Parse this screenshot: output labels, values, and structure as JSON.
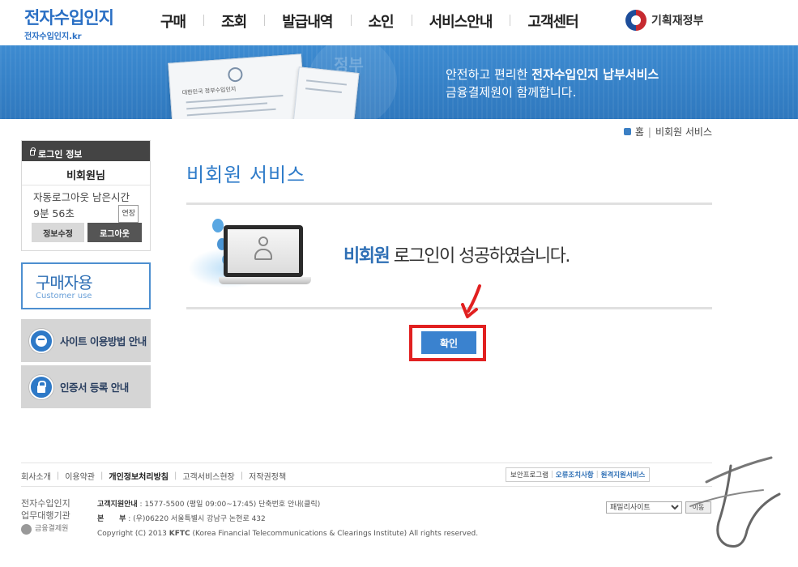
{
  "header": {
    "logo_title": "전자수입인지",
    "logo_sub": "전자수입인지.kr",
    "nav": [
      "구매",
      "조회",
      "발급내역",
      "소인",
      "서비스안내",
      "고객센터"
    ],
    "gov_label": "기획재정부"
  },
  "banner": {
    "line1_pre": "안전하고 편리한 ",
    "line1_strong": "전자수입인지 납부서비스",
    "line2": "금융결제원이 함께합니다.",
    "paper_caption": "대한민국 정부수입인지",
    "seal_text": "정부"
  },
  "breadcrumb": {
    "home": "홈",
    "current": "비회원 서비스"
  },
  "login": {
    "heading": "로그인 정보",
    "user": "비회원님",
    "remain_label": "자동로그아웃 남은시간",
    "remain_time": "9분 56초",
    "extend_label": "연장",
    "edit_label": "정보수정",
    "logout_label": "로그아웃"
  },
  "sidebar": {
    "buy_title": "구매자용",
    "buy_sub": "Customer use",
    "guide_label": "사이트 이용방법 안내",
    "cert_label": "인증서 등록 안내"
  },
  "main": {
    "title": "비회원 서비스",
    "message_highlight": "비회원",
    "message_rest": " 로그인이 성공하였습니다.",
    "confirm_label": "확인"
  },
  "footer": {
    "links": [
      "회사소개",
      "이용약관",
      "개인정보처리방침",
      "고객서비스현장",
      "저작권정책"
    ],
    "util": [
      "보안프로그램",
      "오류조치사항",
      "원격지원서비스"
    ],
    "org_line1": "전자수입인지",
    "org_line2": "업무대행기관",
    "org_logo": "금융결제원",
    "cs_key": "고객지원안내",
    "cs_value": " : 1577-5500 (평일 09:00~17:45) 단축번호 안내(클릭)",
    "hq_key": "본      부",
    "hq_value": " : (우)06220 서울특별시 강남구 논현로 432",
    "copyright_pre": "Copyright (C) 2013 ",
    "copyright_strong": "KFTC",
    "copyright_post": " (Korea Financial Telecommunications & Clearings Institute) All rights reserved.",
    "family_select": "패밀리사이트",
    "go_label": "이동"
  },
  "colors": {
    "brand_blue": "#2e7bc9",
    "banner_blue": "#3584c9",
    "highlight_red": "#e12020"
  },
  "icons": {
    "gov": "government-emblem-icon",
    "home": "home-icon",
    "lock": "lock-icon",
    "guide": "face-icon",
    "cert": "lock-icon",
    "arrow": "red-arrow-icon"
  }
}
